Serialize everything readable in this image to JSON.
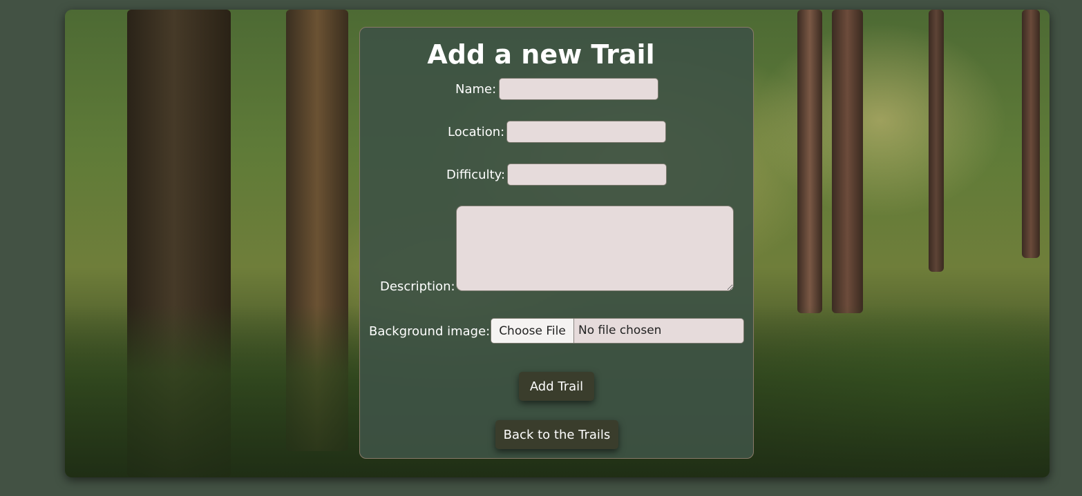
{
  "page": {
    "title": "Add a new Trail"
  },
  "form": {
    "name_label": "Name:",
    "name_value": "",
    "location_label": "Location:",
    "location_value": "",
    "difficulty_label": "Difficulty:",
    "difficulty_value": "",
    "description_label": "Description:",
    "description_value": "",
    "background_label": "Background image:",
    "file_button_label": "Choose File",
    "file_status": "No file chosen"
  },
  "actions": {
    "add_trail_label": "Add Trail",
    "back_label": "Back to the Trails"
  },
  "colors": {
    "page_background": "#435244",
    "panel_background": "#3e5244",
    "input_background": "#e6dbdb",
    "button_background": "#3a3d2c",
    "text": "#ffffff"
  }
}
